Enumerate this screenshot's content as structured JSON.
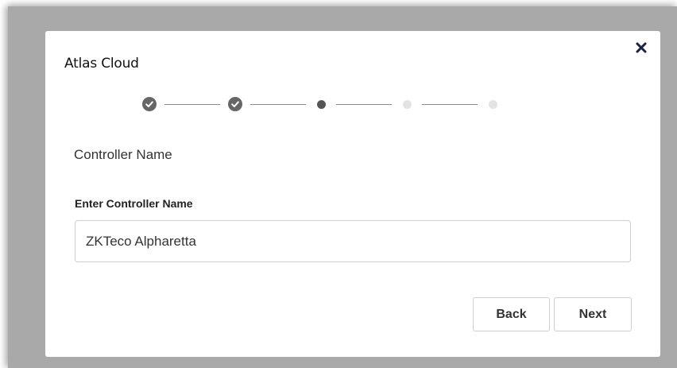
{
  "dialog": {
    "app_title": "Atlas Cloud",
    "close_icon": "close-icon",
    "stepper": {
      "steps": [
        {
          "state": "completed",
          "icon": "check-icon"
        },
        {
          "state": "completed",
          "icon": "check-icon"
        },
        {
          "state": "current",
          "icon": "dot-icon"
        },
        {
          "state": "pending",
          "icon": "dot-icon"
        },
        {
          "state": "pending",
          "icon": "dot-icon"
        }
      ],
      "current_step": 3,
      "total_steps": 5
    },
    "section_title": "Controller Name",
    "field": {
      "label": "Enter Controller Name",
      "value": "ZKTeco Alpharetta"
    },
    "buttons": {
      "back_label": "Back",
      "next_label": "Next"
    }
  },
  "colors": {
    "backdrop": "#a9a9a9",
    "dialog_bg": "#ffffff",
    "step_done": "#666666",
    "step_pending": "#e3e3e3",
    "close_icon": "#1a1f4d"
  }
}
